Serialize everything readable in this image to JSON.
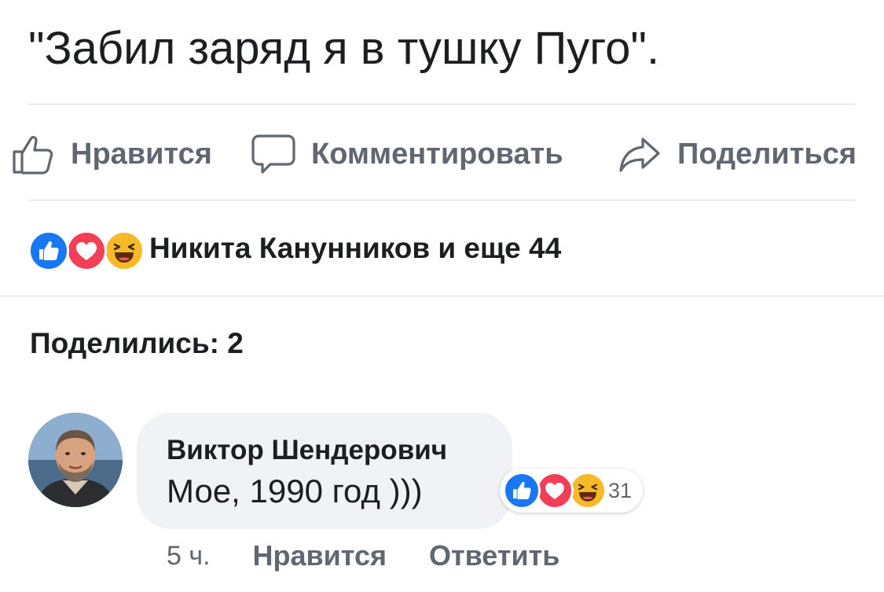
{
  "post": {
    "text": "\"Забил заряд я в тушку Пуго\"."
  },
  "actions": {
    "like_label": "Нравится",
    "comment_label": "Комментировать",
    "share_label": "Поделиться"
  },
  "reactions": {
    "summary": "Никита Канунников и еще 44",
    "icons": [
      "like-icon",
      "love-icon",
      "haha-icon"
    ]
  },
  "shares": {
    "label": "Поделились: 2"
  },
  "comment": {
    "author": "Виктор Шендерович",
    "text": "Мое, 1990 год )))",
    "reaction_count": "31",
    "time": "5 ч.",
    "like_label": "Нравится",
    "reply_label": "Ответить"
  },
  "colors": {
    "like_blue": "#1877f2",
    "love_red": "#f33e58",
    "haha_yellow": "#f7b928",
    "secondary_text": "#606770",
    "divider": "#dadde1",
    "bubble_bg": "#f0f2f5"
  }
}
